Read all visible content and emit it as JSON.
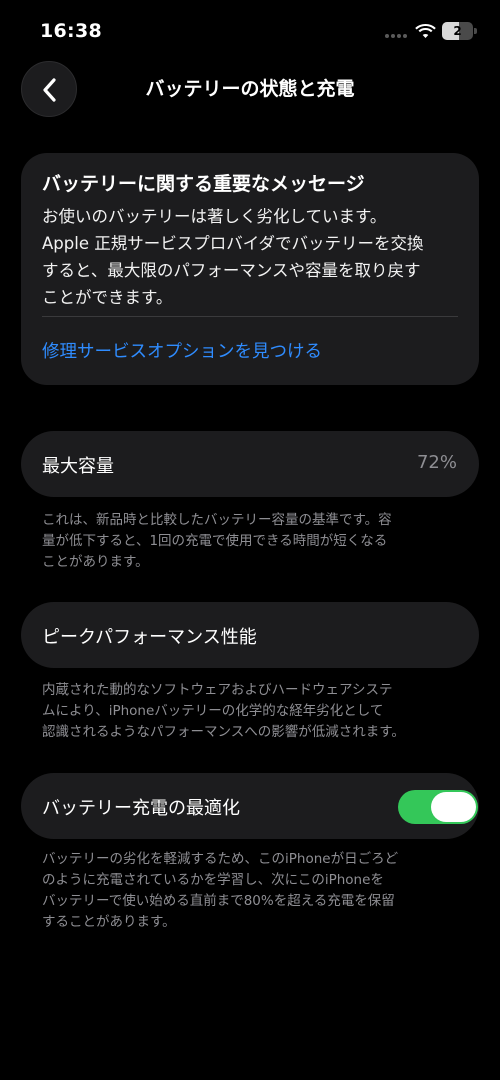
{
  "status_bar": {
    "time": "16:38",
    "battery_level": "2",
    "battery_fraction": 0.55,
    "icons": [
      "signal-dots-icon",
      "wifi-icon",
      "battery-icon"
    ]
  },
  "nav": {
    "back_icon": "chevron-left-icon",
    "title": "バッテリーの状態と充電"
  },
  "message": {
    "title": "バッテリーに関する重要なメッセージ",
    "body_lines": [
      "お使いのバッテリーは著しく劣化しています。",
      "Apple 正規サービスプロバイダでバッテリーを交換",
      "すると、最大限のパフォーマンスや容量を取り戻す",
      "ことができます。"
    ],
    "link": "修理サービスオプションを見つける"
  },
  "max_capacity": {
    "label": "最大容量",
    "value": "72%",
    "footnote_lines": [
      "これは、新品時と比較したバッテリー容量の基準です。容",
      "量が低下すると、1回の充電で使用できる時間が短くなる",
      "ことがあります。"
    ]
  },
  "peak_performance": {
    "label": "ピークパフォーマンス性能",
    "footnote_lines": [
      "内蔵された動的なソフトウェアおよびハードウェアシステ",
      "ムにより、iPhoneバッテリーの化学的な経年劣化として",
      "認識されるようなパフォーマンスへの影響が低減されます。"
    ]
  },
  "optimized_charging": {
    "label": "バッテリー充電の最適化",
    "enabled": true,
    "toggle_color": "#34c759",
    "footnote_lines": [
      "バッテリーの劣化を軽減するため、このiPhoneが日ごろど",
      "のように充電されているかを学習し、次にこのiPhoneを",
      "バッテリーで使い始める直前まで80%を超える充電を保留",
      "することがあります。"
    ]
  },
  "colors": {
    "background": "#000000",
    "card": "#1c1c1e",
    "link": "#2f8cff",
    "secondary_text": "#8e8e93"
  }
}
